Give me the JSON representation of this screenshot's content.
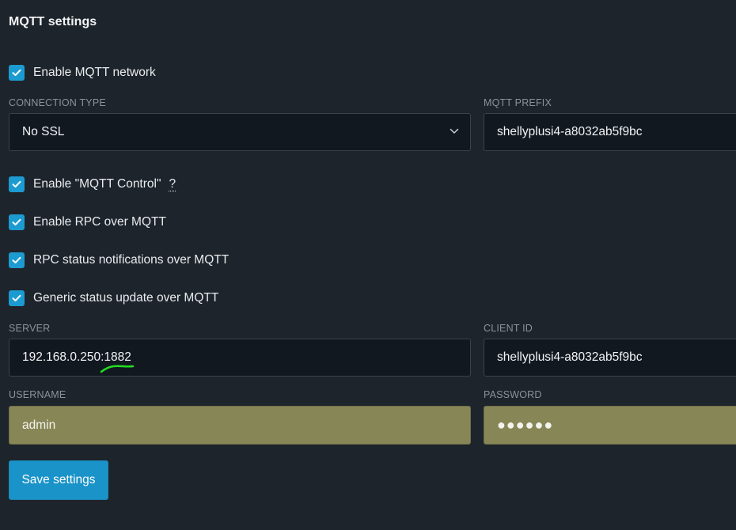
{
  "section": {
    "title": "MQTT settings"
  },
  "checkboxes": {
    "enable_mqtt": {
      "label": "Enable MQTT network",
      "checked": true
    },
    "mqtt_control": {
      "label": "Enable \"MQTT Control\"",
      "help": "?",
      "checked": true
    },
    "rpc_over_mqtt": {
      "label": "Enable RPC over MQTT",
      "checked": true
    },
    "rpc_status": {
      "label": "RPC status notifications over MQTT",
      "checked": true
    },
    "generic_status": {
      "label": "Generic status update over MQTT",
      "checked": true
    }
  },
  "fields": {
    "connection_type": {
      "label": "CONNECTION TYPE",
      "value": "No SSL"
    },
    "mqtt_prefix": {
      "label": "MQTT PREFIX",
      "value": "shellyplusi4-a8032ab5f9bc"
    },
    "server": {
      "label": "SERVER",
      "value": "192.168.0.250:1882"
    },
    "client_id": {
      "label": "CLIENT ID",
      "value": "shellyplusi4-a8032ab5f9bc"
    },
    "username": {
      "label": "USERNAME",
      "value": "admin"
    },
    "password": {
      "label": "PASSWORD",
      "value": "●●●●●●"
    }
  },
  "buttons": {
    "save": "Save settings"
  },
  "colors": {
    "background": "#1e242b",
    "accent": "#1993c8",
    "autofill": "#878657",
    "annotation": "#22dd22"
  },
  "icons": {
    "checkbox": "check-icon",
    "select": "chevron-down-icon"
  }
}
